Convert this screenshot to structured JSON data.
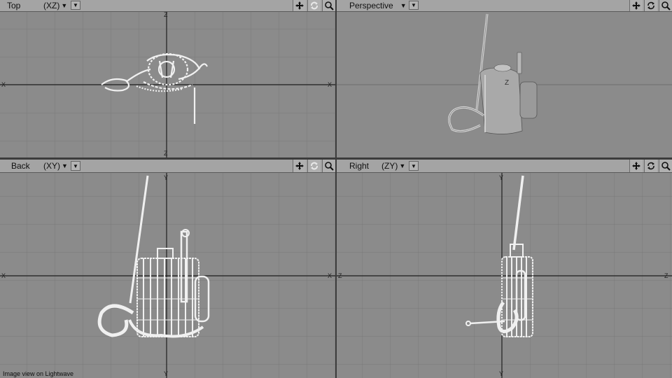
{
  "viewports": [
    {
      "id": "top",
      "name": "Top",
      "mode": "(XZ)",
      "axis_h": "X",
      "axis_v": "Z"
    },
    {
      "id": "perspective",
      "name": "Perspective",
      "mode": "",
      "axis_h": "",
      "axis_v": ""
    },
    {
      "id": "back",
      "name": "Back",
      "mode": "(XY)",
      "axis_h": "X",
      "axis_v": "Y"
    },
    {
      "id": "right",
      "name": "Right",
      "mode": "(ZY)",
      "axis_h": "Z",
      "axis_v": "Y"
    }
  ],
  "toolbar": {
    "menu_glyph": "▼",
    "icons": [
      "move-icon",
      "rotate-icon",
      "zoom-icon"
    ]
  },
  "status": {
    "caption": "Image view on Lightwave"
  },
  "colors": {
    "viewport_bg": "#8b8b8b",
    "grid": "#7a7a7a",
    "axis": "#1e1e1e",
    "wire": "#f0f0f0",
    "header": "#a4a4a4"
  }
}
